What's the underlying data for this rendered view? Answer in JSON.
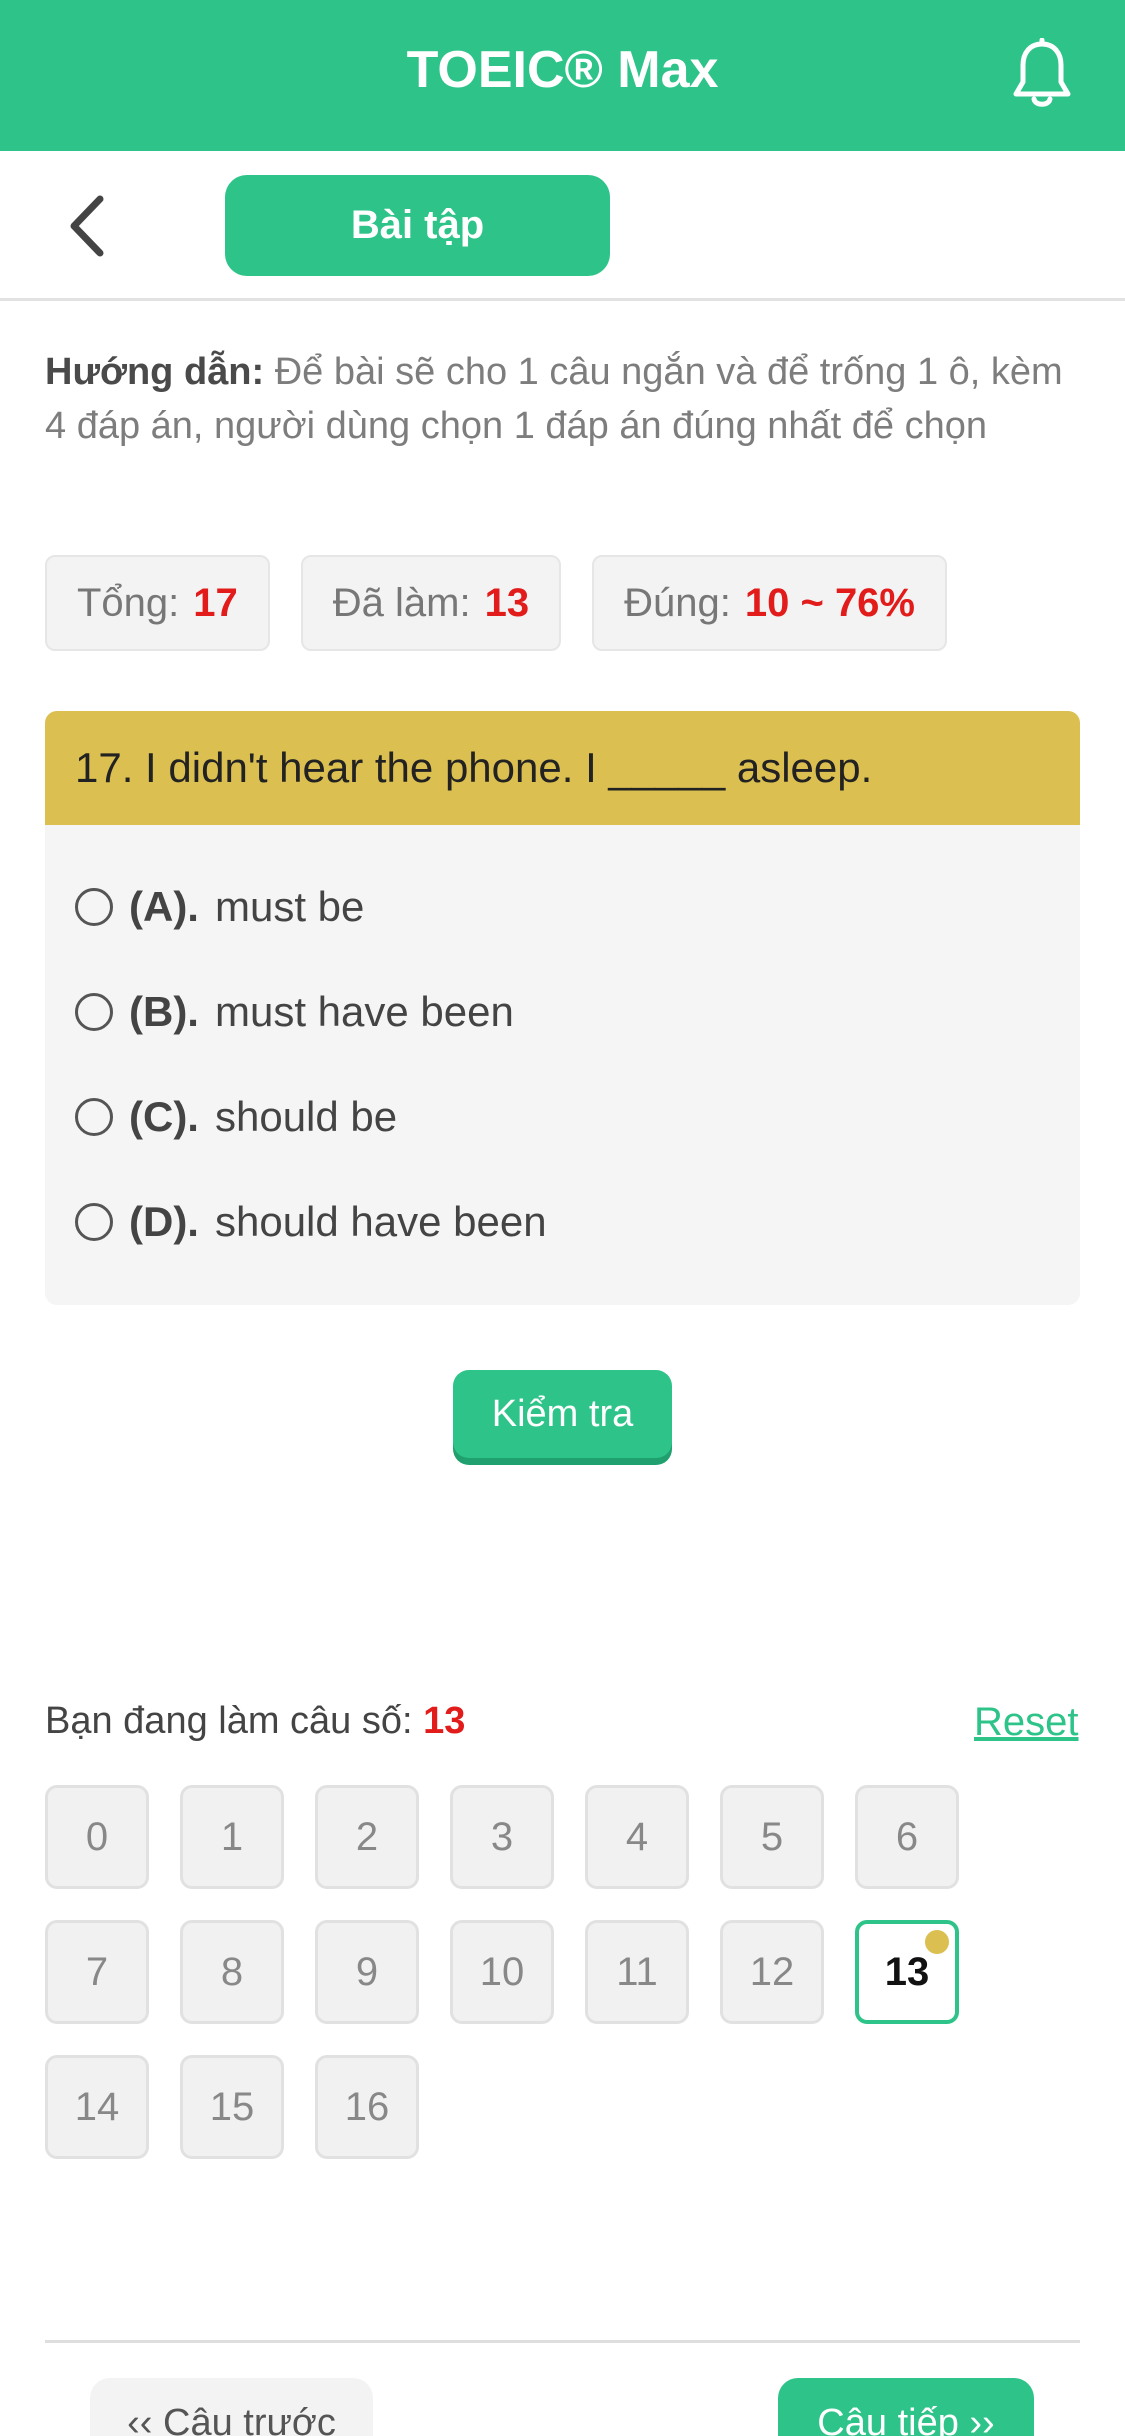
{
  "app": {
    "title": "TOEIC® Max"
  },
  "icons": {
    "bell": "bell-icon",
    "back": "chevron-left-icon",
    "radio": "radio-empty-icon"
  },
  "colors": {
    "primary": "#2ec489",
    "question_header": "#dbbf50",
    "highlight": "#e21b1b"
  },
  "nav": {
    "tab_label": "Bài tập"
  },
  "guide": {
    "label": "Hướng dẫn:",
    "text": " Để bài sẽ cho 1 câu ngắn và để trống 1 ô, kèm 4 đáp án, người dùng chọn 1 đáp án đúng nhất để chọn"
  },
  "stats": [
    {
      "label": "Tổng:",
      "value": "17"
    },
    {
      "label": "Đã làm:",
      "value": "13"
    },
    {
      "label": "Đúng:",
      "value": "10 ~ 76%"
    }
  ],
  "question": {
    "text": "17. I didn't hear the phone. I _____ asleep.",
    "options": [
      {
        "key": "(A).",
        "text": "must be"
      },
      {
        "key": "(B).",
        "text": "must have been"
      },
      {
        "key": "(C).",
        "text": "should be"
      },
      {
        "key": "(D).",
        "text": "should have been"
      }
    ]
  },
  "check_label": "Kiểm tra",
  "progress": {
    "label": "Bạn đang làm câu số:",
    "current": "13",
    "reset_label": "Reset"
  },
  "grid": [
    "0",
    "1",
    "2",
    "3",
    "4",
    "5",
    "6",
    "7",
    "8",
    "9",
    "10",
    "11",
    "12",
    "13",
    "14",
    "15",
    "16"
  ],
  "footer": {
    "prev_label": "‹‹ Câu trước",
    "next_label": "Câu tiếp ››"
  }
}
